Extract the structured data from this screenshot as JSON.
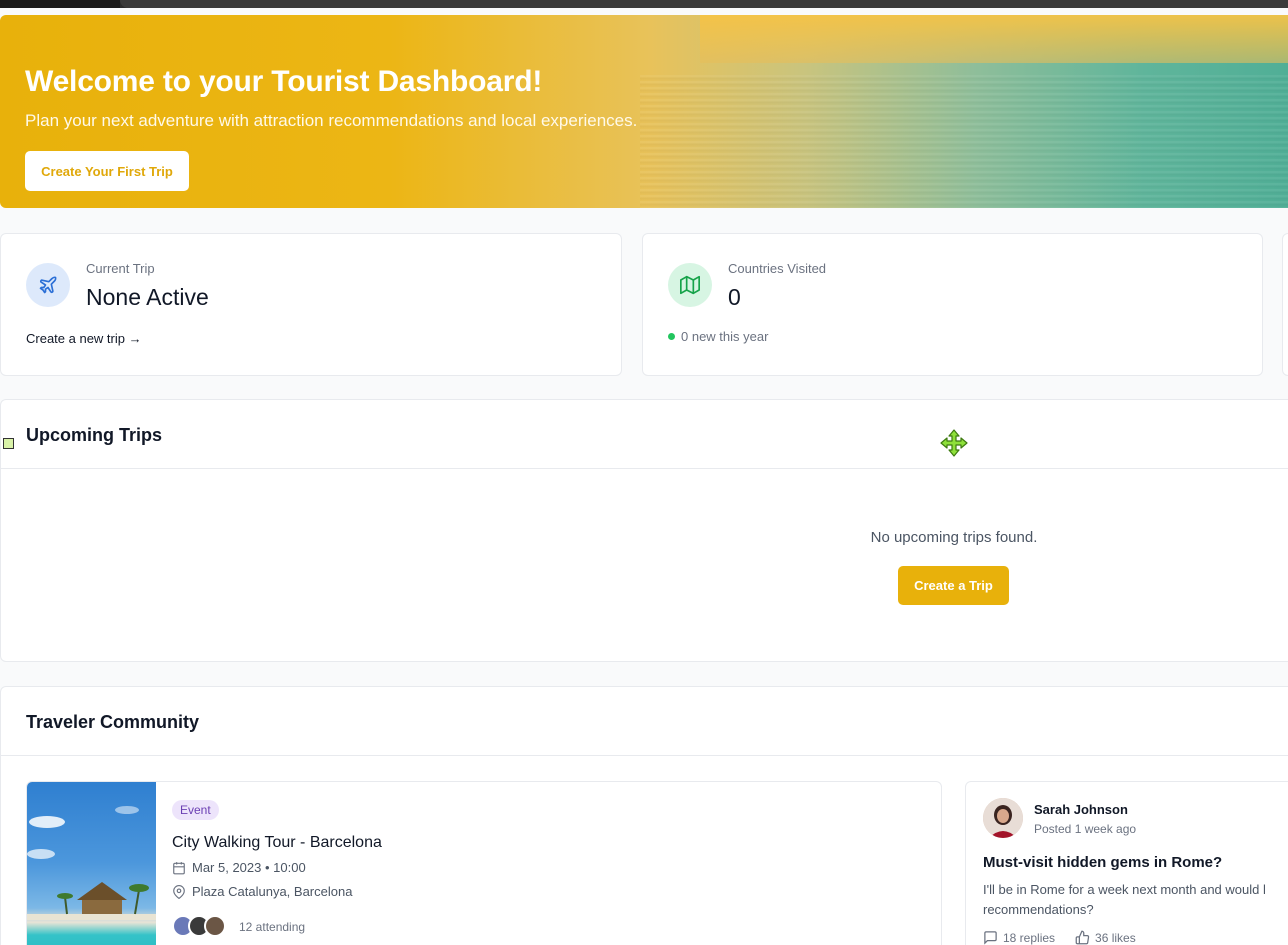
{
  "hero": {
    "title": "Welcome to your Tourist Dashboard!",
    "subtitle": "Plan your next adventure with attraction recommendations and local experiences.",
    "button_label": "Create Your First Trip",
    "accent_color": "#e8b10b"
  },
  "stats": {
    "current_trip": {
      "label": "Current Trip",
      "value": "None Active",
      "link": "Create a new trip →",
      "icon": "plane-icon"
    },
    "countries_visited": {
      "label": "Countries Visited",
      "value": "0",
      "note": "0 new this year",
      "icon": "map-icon"
    }
  },
  "upcoming": {
    "title": "Upcoming Trips",
    "empty_text": "No upcoming trips found.",
    "button_label": "Create a Trip"
  },
  "community": {
    "title": "Traveler Community",
    "event": {
      "badge": "Event",
      "title": "City Walking Tour - Barcelona",
      "datetime": "Mar 5, 2023 • 10:00",
      "location": "Plaza Catalunya, Barcelona",
      "attending": "12 attending"
    },
    "post": {
      "author": "Sarah Johnson",
      "posted": "Posted 1 week ago",
      "title": "Must-visit hidden gems in Rome?",
      "body": "I'll be in Rome for a week next month and would l recommendations?",
      "replies": "18 replies",
      "likes": "36 likes"
    }
  }
}
